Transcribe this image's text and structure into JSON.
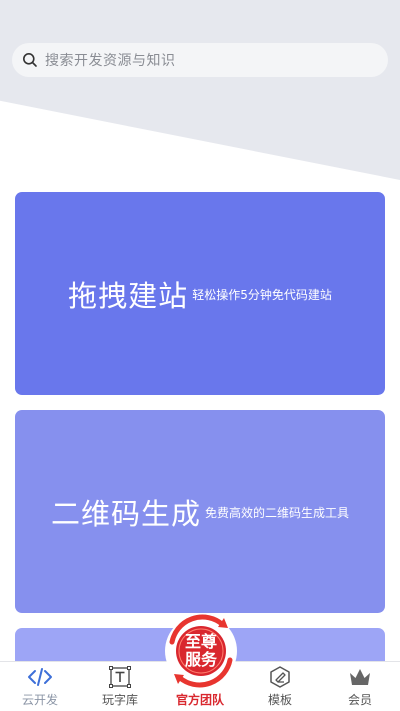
{
  "search": {
    "placeholder": "搜索开发资源与知识"
  },
  "cards": [
    {
      "title": "拖拽建站",
      "subtitle": "轻松操作5分钟免代码建站"
    },
    {
      "title": "二维码生成",
      "subtitle": "免费高效的二维码生成工具"
    }
  ],
  "center_badge": {
    "line1": "至尊",
    "line2": "服务"
  },
  "nav": {
    "items": [
      {
        "label": "云开发",
        "icon": "code-icon"
      },
      {
        "label": "玩字库",
        "icon": "text-icon"
      },
      {
        "label": "官方团队",
        "icon": "badge-icon"
      },
      {
        "label": "模板",
        "icon": "template-icon"
      },
      {
        "label": "会员",
        "icon": "crown-icon"
      }
    ]
  },
  "colors": {
    "card1": "#6977ec",
    "card2": "#8690ee",
    "card3": "#9da5f6",
    "accent_red": "#d9272e",
    "code_icon_blue": "#3d6fd8"
  }
}
